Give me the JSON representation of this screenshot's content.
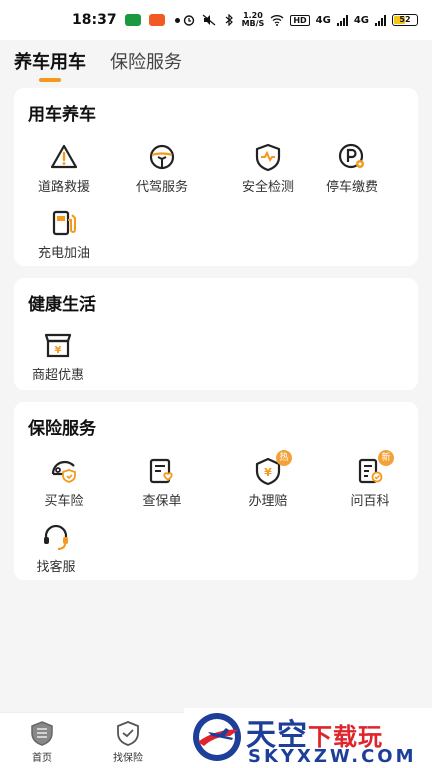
{
  "status_bar": {
    "time": "18:37",
    "speed_top": "1.20",
    "speed_bottom": "MB/S",
    "hd": "HD",
    "network1": "4G",
    "network2": "4G",
    "battery": "52",
    "battery_level": 0.52
  },
  "tabs": [
    {
      "label": "养车用车",
      "active": true
    },
    {
      "label": "保险服务",
      "active": false
    }
  ],
  "sections": {
    "car": {
      "title": "用车养车",
      "items": [
        {
          "label": "道路救援",
          "icon": "warning-triangle-icon"
        },
        {
          "label": "代驾服务",
          "icon": "steering-wheel-icon"
        },
        {
          "label": "安全检测",
          "icon": "shield-pulse-icon"
        },
        {
          "label": "停车缴费",
          "icon": "parking-icon"
        },
        {
          "label": "充电加油",
          "icon": "fuel-pump-icon"
        }
      ]
    },
    "health": {
      "title": "健康生活",
      "items": [
        {
          "label": "商超优惠",
          "icon": "store-icon"
        }
      ]
    },
    "insurance": {
      "title": "保险服务",
      "items": [
        {
          "label": "买车险",
          "icon": "car-shield-icon"
        },
        {
          "label": "查保单",
          "icon": "policy-document-icon"
        },
        {
          "label": "办理赔",
          "icon": "claim-shield-icon",
          "tag": "热"
        },
        {
          "label": "问百科",
          "icon": "encyclopedia-icon",
          "tag": "新"
        },
        {
          "label": "找客服",
          "icon": "headset-icon"
        }
      ]
    }
  },
  "bottom_nav": [
    {
      "label": "首页",
      "icon": "home-shield-icon"
    },
    {
      "label": "找保险",
      "icon": "insurance-check-icon"
    }
  ],
  "watermark": {
    "main_blue": "天空",
    "main_red": "下载玩",
    "sub": "SKYXZW.COM"
  },
  "colors": {
    "accent": "#f39a1e",
    "background": "#f5f5f5",
    "card": "#ffffff"
  }
}
